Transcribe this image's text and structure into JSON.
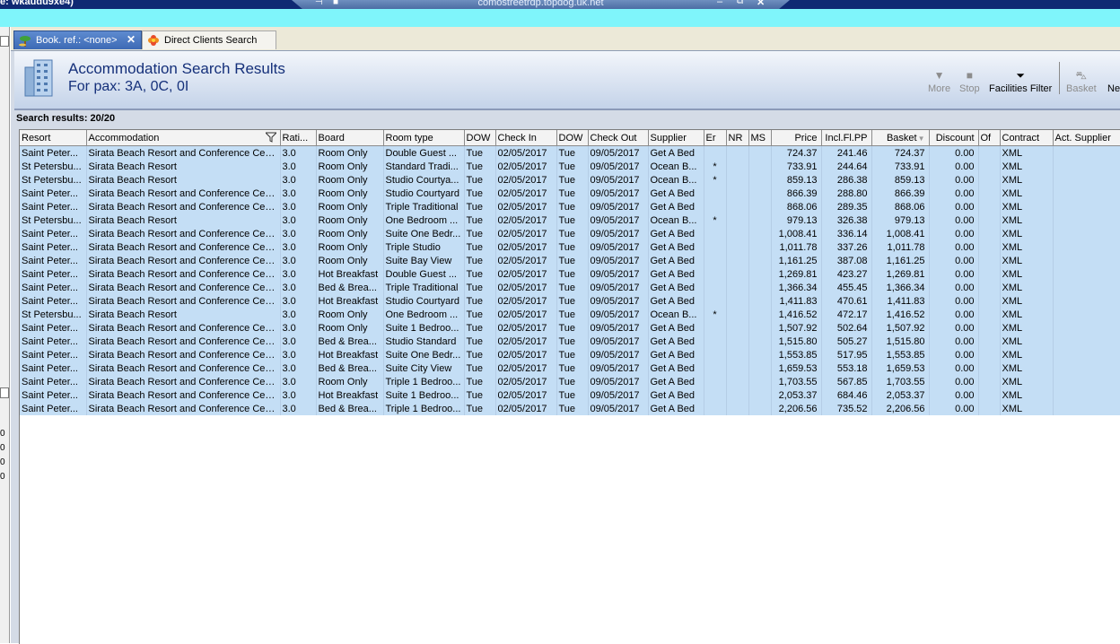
{
  "remote": {
    "window_title": "e: wkaudu9xe4)",
    "rdp_title": "comostreetrdp.topdog.uk.net"
  },
  "left_panel": {
    "numbers": [
      "0",
      "0",
      "0",
      "0"
    ]
  },
  "tabs": [
    {
      "label": "Book. ref.: <none>",
      "close": "✕"
    },
    {
      "label": "Direct Clients Search"
    }
  ],
  "header": {
    "title": "Accommodation Search Results",
    "subtitle": "For pax: 3A, 0C, 0I"
  },
  "toolbar": {
    "more": "More",
    "stop": "Stop",
    "facilities": "Facilities Filter",
    "basket": "Basket",
    "next": "Ne"
  },
  "results_label": "Search results: 20/20",
  "columns": [
    "Resort",
    "Accommodation",
    "Rati...",
    "Board",
    "Room type",
    "DOW",
    "Check In",
    "DOW",
    "Check Out",
    "Supplier",
    "Er",
    "NR",
    "MS",
    "Price",
    "Incl.Fl.PP",
    "Basket",
    "Discount",
    "Of",
    "Contract",
    "Act. Supplier"
  ],
  "rows": [
    [
      "Saint Peter...",
      "Sirata Beach Resort and Conference Cen...",
      "3.0",
      "Room Only",
      "Double Guest ...",
      "Tue",
      "02/05/2017",
      "Tue",
      "09/05/2017",
      "Get A Bed",
      "",
      "",
      "",
      "724.37",
      "241.46",
      "724.37",
      "0.00",
      "",
      "XML",
      ""
    ],
    [
      "St Petersbu...",
      "Sirata Beach Resort",
      "3.0",
      "Room Only",
      "Standard Tradi...",
      "Tue",
      "02/05/2017",
      "Tue",
      "09/05/2017",
      "Ocean B...",
      "*",
      "",
      "",
      "733.91",
      "244.64",
      "733.91",
      "0.00",
      "",
      "XML",
      ""
    ],
    [
      "St Petersbu...",
      "Sirata Beach Resort",
      "3.0",
      "Room Only",
      "Studio Courtya...",
      "Tue",
      "02/05/2017",
      "Tue",
      "09/05/2017",
      "Ocean B...",
      "*",
      "",
      "",
      "859.13",
      "286.38",
      "859.13",
      "0.00",
      "",
      "XML",
      ""
    ],
    [
      "Saint Peter...",
      "Sirata Beach Resort and Conference Cen...",
      "3.0",
      "Room Only",
      "Studio Courtyard",
      "Tue",
      "02/05/2017",
      "Tue",
      "09/05/2017",
      "Get A Bed",
      "",
      "",
      "",
      "866.39",
      "288.80",
      "866.39",
      "0.00",
      "",
      "XML",
      ""
    ],
    [
      "Saint Peter...",
      "Sirata Beach Resort and Conference Cen...",
      "3.0",
      "Room Only",
      "Triple Traditional",
      "Tue",
      "02/05/2017",
      "Tue",
      "09/05/2017",
      "Get A Bed",
      "",
      "",
      "",
      "868.06",
      "289.35",
      "868.06",
      "0.00",
      "",
      "XML",
      ""
    ],
    [
      "St Petersbu...",
      "Sirata Beach Resort",
      "3.0",
      "Room Only",
      "One Bedroom ...",
      "Tue",
      "02/05/2017",
      "Tue",
      "09/05/2017",
      "Ocean B...",
      "*",
      "",
      "",
      "979.13",
      "326.38",
      "979.13",
      "0.00",
      "",
      "XML",
      ""
    ],
    [
      "Saint Peter...",
      "Sirata Beach Resort and Conference Cen...",
      "3.0",
      "Room Only",
      "Suite One Bedr...",
      "Tue",
      "02/05/2017",
      "Tue",
      "09/05/2017",
      "Get A Bed",
      "",
      "",
      "",
      "1,008.41",
      "336.14",
      "1,008.41",
      "0.00",
      "",
      "XML",
      ""
    ],
    [
      "Saint Peter...",
      "Sirata Beach Resort and Conference Cen...",
      "3.0",
      "Room Only",
      "Triple Studio",
      "Tue",
      "02/05/2017",
      "Tue",
      "09/05/2017",
      "Get A Bed",
      "",
      "",
      "",
      "1,011.78",
      "337.26",
      "1,011.78",
      "0.00",
      "",
      "XML",
      ""
    ],
    [
      "Saint Peter...",
      "Sirata Beach Resort and Conference Cen...",
      "3.0",
      "Room Only",
      "Suite Bay View",
      "Tue",
      "02/05/2017",
      "Tue",
      "09/05/2017",
      "Get A Bed",
      "",
      "",
      "",
      "1,161.25",
      "387.08",
      "1,161.25",
      "0.00",
      "",
      "XML",
      ""
    ],
    [
      "Saint Peter...",
      "Sirata Beach Resort and Conference Cen...",
      "3.0",
      "Hot Breakfast",
      "Double Guest ...",
      "Tue",
      "02/05/2017",
      "Tue",
      "09/05/2017",
      "Get A Bed",
      "",
      "",
      "",
      "1,269.81",
      "423.27",
      "1,269.81",
      "0.00",
      "",
      "XML",
      ""
    ],
    [
      "Saint Peter...",
      "Sirata Beach Resort and Conference Cen...",
      "3.0",
      "Bed & Brea...",
      "Triple Traditional",
      "Tue",
      "02/05/2017",
      "Tue",
      "09/05/2017",
      "Get A Bed",
      "",
      "",
      "",
      "1,366.34",
      "455.45",
      "1,366.34",
      "0.00",
      "",
      "XML",
      ""
    ],
    [
      "Saint Peter...",
      "Sirata Beach Resort and Conference Cen...",
      "3.0",
      "Hot Breakfast",
      "Studio Courtyard",
      "Tue",
      "02/05/2017",
      "Tue",
      "09/05/2017",
      "Get A Bed",
      "",
      "",
      "",
      "1,411.83",
      "470.61",
      "1,411.83",
      "0.00",
      "",
      "XML",
      ""
    ],
    [
      "St Petersbu...",
      "Sirata Beach Resort",
      "3.0",
      "Room Only",
      "One Bedroom ...",
      "Tue",
      "02/05/2017",
      "Tue",
      "09/05/2017",
      "Ocean B...",
      "*",
      "",
      "",
      "1,416.52",
      "472.17",
      "1,416.52",
      "0.00",
      "",
      "XML",
      ""
    ],
    [
      "Saint Peter...",
      "Sirata Beach Resort and Conference Cen...",
      "3.0",
      "Room Only",
      "Suite 1 Bedroo...",
      "Tue",
      "02/05/2017",
      "Tue",
      "09/05/2017",
      "Get A Bed",
      "",
      "",
      "",
      "1,507.92",
      "502.64",
      "1,507.92",
      "0.00",
      "",
      "XML",
      ""
    ],
    [
      "Saint Peter...",
      "Sirata Beach Resort and Conference Cen...",
      "3.0",
      "Bed & Brea...",
      "Studio Standard",
      "Tue",
      "02/05/2017",
      "Tue",
      "09/05/2017",
      "Get A Bed",
      "",
      "",
      "",
      "1,515.80",
      "505.27",
      "1,515.80",
      "0.00",
      "",
      "XML",
      ""
    ],
    [
      "Saint Peter...",
      "Sirata Beach Resort and Conference Cen...",
      "3.0",
      "Hot Breakfast",
      "Suite One Bedr...",
      "Tue",
      "02/05/2017",
      "Tue",
      "09/05/2017",
      "Get A Bed",
      "",
      "",
      "",
      "1,553.85",
      "517.95",
      "1,553.85",
      "0.00",
      "",
      "XML",
      ""
    ],
    [
      "Saint Peter...",
      "Sirata Beach Resort and Conference Cen...",
      "3.0",
      "Bed & Brea...",
      "Suite City View",
      "Tue",
      "02/05/2017",
      "Tue",
      "09/05/2017",
      "Get A Bed",
      "",
      "",
      "",
      "1,659.53",
      "553.18",
      "1,659.53",
      "0.00",
      "",
      "XML",
      ""
    ],
    [
      "Saint Peter...",
      "Sirata Beach Resort and Conference Cen...",
      "3.0",
      "Room Only",
      "Triple 1 Bedroo...",
      "Tue",
      "02/05/2017",
      "Tue",
      "09/05/2017",
      "Get A Bed",
      "",
      "",
      "",
      "1,703.55",
      "567.85",
      "1,703.55",
      "0.00",
      "",
      "XML",
      ""
    ],
    [
      "Saint Peter...",
      "Sirata Beach Resort and Conference Cen...",
      "3.0",
      "Hot Breakfast",
      "Suite 1 Bedroo...",
      "Tue",
      "02/05/2017",
      "Tue",
      "09/05/2017",
      "Get A Bed",
      "",
      "",
      "",
      "2,053.37",
      "684.46",
      "2,053.37",
      "0.00",
      "",
      "XML",
      ""
    ],
    [
      "Saint Peter...",
      "Sirata Beach Resort and Conference Cen...",
      "3.0",
      "Bed & Brea...",
      "Triple 1 Bedroo...",
      "Tue",
      "02/05/2017",
      "Tue",
      "09/05/2017",
      "Get A Bed",
      "",
      "",
      "",
      "2,206.56",
      "735.52",
      "2,206.56",
      "0.00",
      "",
      "XML",
      ""
    ]
  ],
  "colors": {
    "row_bg": "#c4def5",
    "title_text": "#15307a",
    "tab_active": "#3d6ab5",
    "remote_bar": "#0f2a73",
    "cyan_strip": "#7ff5fb"
  }
}
